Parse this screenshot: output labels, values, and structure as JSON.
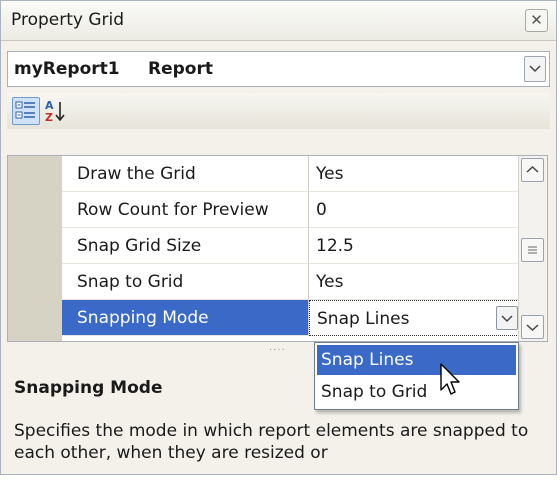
{
  "window": {
    "title": "Property Grid",
    "close_icon": "close-icon"
  },
  "selector": {
    "object_name": "myReport1",
    "object_type": "Report"
  },
  "toolbar": {
    "categorized_icon": "categorized-icon",
    "alphabetical_icon": "sort-alphabetical-icon",
    "alphabetical_glyph_top": "A",
    "alphabetical_glyph_bottom": "Z"
  },
  "properties": [
    {
      "name": "Draw the Grid",
      "value": "Yes"
    },
    {
      "name": "Row Count for Preview",
      "value": "0"
    },
    {
      "name": "Snap Grid Size",
      "value": "12.5"
    },
    {
      "name": "Snap to Grid",
      "value": "Yes"
    },
    {
      "name": "Snapping Mode",
      "value": "Snap Lines"
    }
  ],
  "dropdown_options": [
    {
      "label": "Snap Lines",
      "highlighted": true
    },
    {
      "label": "Snap to Grid",
      "highlighted": false
    }
  ],
  "description": {
    "title": "Snapping Mode",
    "text": "Specifies the mode in which report elements are snapped to each other, when they are resized or"
  },
  "colors": {
    "selection": "#3a69c7",
    "gutter": "#d6d3c5",
    "panel": "#f3f1ea"
  }
}
